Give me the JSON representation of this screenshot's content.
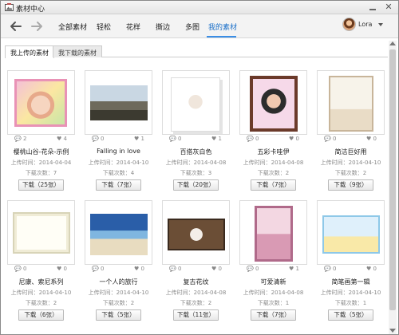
{
  "window": {
    "title": "素材中心"
  },
  "nav_tabs": [
    {
      "label": "全部素材"
    },
    {
      "label": "轻松"
    },
    {
      "label": "花样"
    },
    {
      "label": "撕边"
    },
    {
      "label": "多图"
    },
    {
      "label": "我的素材",
      "active": true
    }
  ],
  "user": {
    "name": "Lora"
  },
  "sub_tabs": [
    {
      "label": "我上传的素材",
      "active": true
    },
    {
      "label": "我下载的素材",
      "active": false
    }
  ],
  "icons": {
    "app": "image-icon",
    "back": "arrow-left-icon",
    "forward": "arrow-right-icon",
    "views": "comment-icon",
    "likes": "heart-icon"
  },
  "colors": {
    "accent": "#1a6fc8",
    "active_underline": "#3a8ee6"
  },
  "items": [
    {
      "name": "樱桃山谷-花朵-示例",
      "views": "2",
      "likes": "4",
      "upload": "上传时间：2014-04-04",
      "downloads": "下载次数：7",
      "button": "下载（25张）"
    },
    {
      "name": "Falling in love",
      "views": "0",
      "likes": "1",
      "upload": "上传时间：2014-04-10",
      "downloads": "下载次数：4",
      "button": "下载（7张）"
    },
    {
      "name": "百搭灰白色",
      "views": "0",
      "likes": "1",
      "upload": "上传时间：2014-04-08",
      "downloads": "下载次数：3",
      "button": "下载（20张）"
    },
    {
      "name": "五彩卡哇伊",
      "views": "0",
      "likes": "0",
      "upload": "上传时间：2014-04-08",
      "downloads": "下载次数：2",
      "button": "下载（7张）"
    },
    {
      "name": "简洁巨好用",
      "views": "0",
      "likes": "0",
      "upload": "上传时间：2014-04-10",
      "downloads": "下载次数：2",
      "button": "下载（9张）"
    },
    {
      "name": "尼康、索尼系列",
      "views": "0",
      "likes": "0",
      "upload": "上传时间：2014-04-10",
      "downloads": "下载次数：2",
      "button": "下载（6张）"
    },
    {
      "name": "一个人的旅行",
      "views": "0",
      "likes": "0",
      "upload": "上传时间：2014-04-10",
      "downloads": "下载次数：2",
      "button": "下载（5张）"
    },
    {
      "name": "复古花纹",
      "views": "0",
      "likes": "0",
      "upload": "上传时间：2014-04-08",
      "downloads": "下载次数：2",
      "button": "下载（11张）"
    },
    {
      "name": "可爱清新",
      "views": "0",
      "likes": "1",
      "upload": "上传时间：2014-04-08",
      "downloads": "下载次数：1",
      "button": "下载（7张）"
    },
    {
      "name": "简笔画第一辑",
      "views": "0",
      "likes": "0",
      "upload": "上传时间：2014-04-10",
      "downloads": "下载次数：1",
      "button": "下载（5张）"
    }
  ]
}
